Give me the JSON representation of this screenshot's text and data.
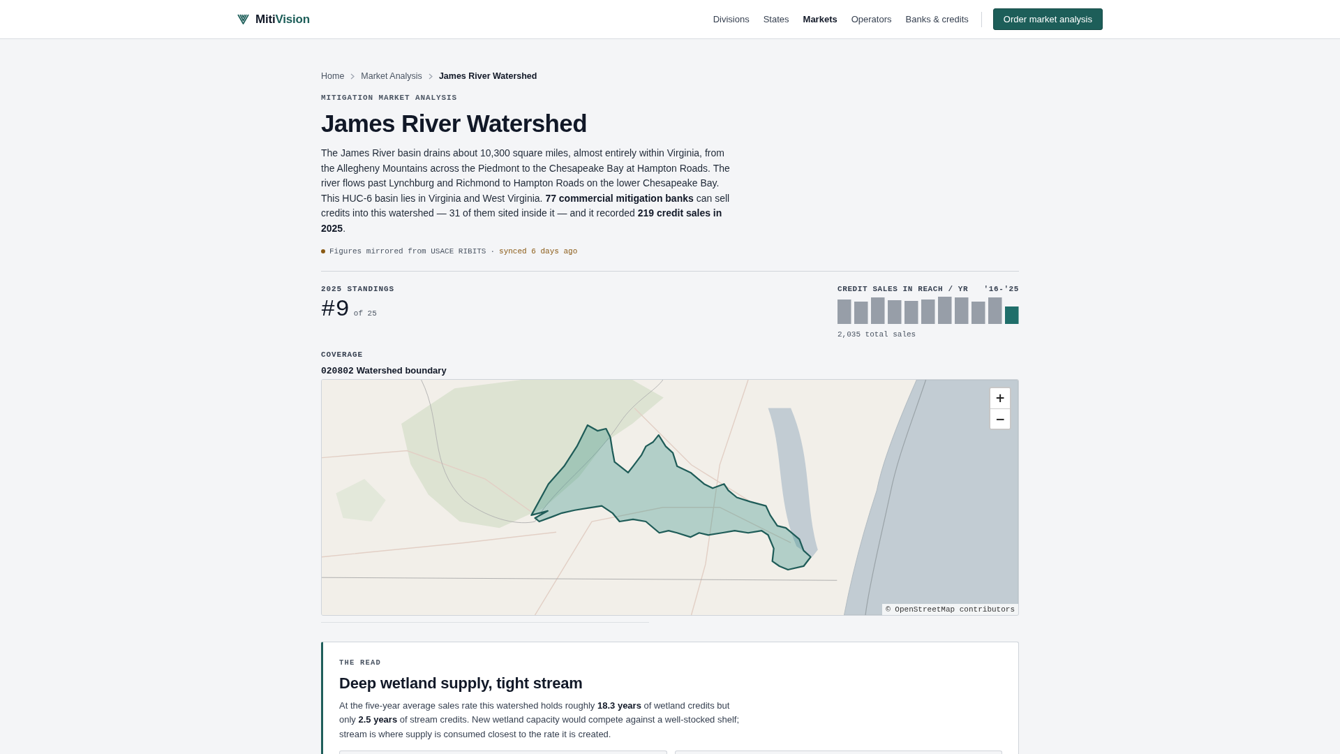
{
  "header": {
    "brand": {
      "name": "Miti",
      "accent": "Vision"
    },
    "nav": [
      {
        "label": "Divisions",
        "selected": false
      },
      {
        "label": "States",
        "selected": false
      },
      {
        "label": "Markets",
        "selected": true
      },
      {
        "label": "Operators",
        "selected": false
      },
      {
        "label": "Banks & credits",
        "selected": false
      }
    ],
    "cta": "Order market analysis"
  },
  "breadcrumb": [
    {
      "label": "Home",
      "current": false
    },
    {
      "label": "Market Analysis",
      "current": false
    },
    {
      "label": "James River Watershed",
      "current": true
    }
  ],
  "eyebrow": "MITIGATION MARKET ANALYSIS",
  "title": "James River Watershed",
  "summary": "The James River basin drains about 10,300 square miles, almost entirely within Virginia, from the Allegheny Mountains across the Piedmont to the Chesapeake Bay at Hampton Roads. The river flows past Lynchburg and Richmond to Hampton Roads on the lower Chesapeake Bay. This HUC-6 basin lies in Virginia and West Virginia. **77 commercial mitigation banks** can sell credits into this watershed — 31 of them sited inside it — and it recorded **219 credit sales in 2025**.",
  "source": {
    "text": "Figures mirrored from USACE RIBITS",
    "separator": "·",
    "synced": "synced 6 days ago"
  },
  "standings": {
    "label": "2025 STANDINGS",
    "rank": "#9",
    "total": "of 25"
  },
  "sales_chart": {
    "title": "CREDIT SALES IN REACH / YR",
    "range": "'16-'25",
    "total": "2,035 total sales"
  },
  "coverage": {
    "label": "COVERAGE",
    "code": "020802",
    "name": "Watershed boundary"
  },
  "map": {
    "zoom_in": "+",
    "zoom_out": "−",
    "attribution": "© OpenStreetMap contributors"
  },
  "read": {
    "label": "THE READ",
    "title": "Deep wetland supply, tight stream",
    "body": "At the five-year average sales rate this watershed holds roughly **18.3 years** of wetland credits but only **2.5 years** of stream credits. New wetland capacity would compete against a well-stocked shelf; stream is where supply is consumed closest to the rate it is created."
  }
}
